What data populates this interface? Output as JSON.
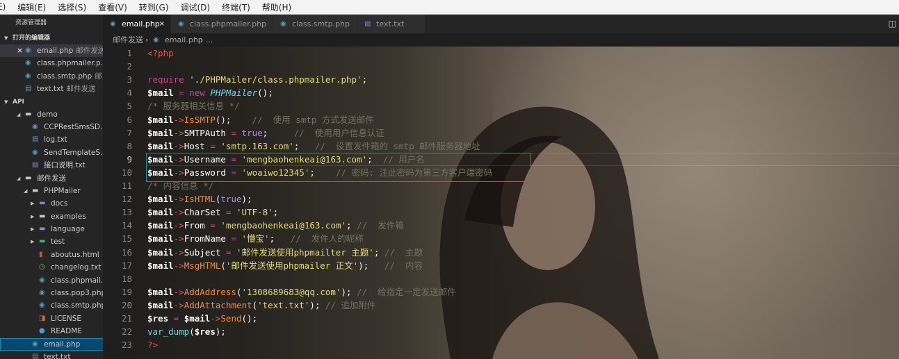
{
  "menu": [
    "E)",
    "编辑(E)",
    "选择(S)",
    "查看(V)",
    "转到(G)",
    "调试(D)",
    "终端(T)",
    "帮助(H)"
  ],
  "sidebar": {
    "title": "资源管理器",
    "open_editors_header": "打开的编辑器",
    "open_editors": [
      {
        "name": "email.php",
        "hint": "邮件发送",
        "icon": "php-icon",
        "active": true,
        "close": "×"
      },
      {
        "name": "class.phpmailer.p...",
        "hint": "",
        "icon": "php-icon"
      },
      {
        "name": "class.smtp.php",
        "hint": "邮...",
        "icon": "php-icon"
      },
      {
        "name": "text.txt",
        "hint": "邮件发送",
        "icon": "file-text-icon"
      }
    ],
    "api_header": "API",
    "tree": [
      {
        "name": "demo",
        "type": "folder",
        "depth": 1,
        "open": true
      },
      {
        "name": "CCPRestSmsSD...",
        "type": "php",
        "depth": 2
      },
      {
        "name": "log.txt",
        "type": "txt",
        "depth": 2
      },
      {
        "name": "SendTemplateS...",
        "type": "php",
        "depth": 2
      },
      {
        "name": "接口说明.txt",
        "type": "txt",
        "depth": 2
      },
      {
        "name": "邮件发送",
        "type": "folder",
        "depth": 1,
        "open": true
      },
      {
        "name": "PHPMailer",
        "type": "folder-special",
        "depth": 2,
        "open": true
      },
      {
        "name": "docs",
        "type": "folder-docs",
        "depth": 3,
        "open": false
      },
      {
        "name": "examples",
        "type": "folder",
        "depth": 3,
        "open": false
      },
      {
        "name": "language",
        "type": "folder-lang",
        "depth": 3,
        "open": false
      },
      {
        "name": "test",
        "type": "folder-test",
        "depth": 3,
        "open": false
      },
      {
        "name": "aboutus.html",
        "type": "html",
        "depth": 3
      },
      {
        "name": "changelog.txt",
        "type": "changelog",
        "depth": 3
      },
      {
        "name": "class.phpmail...",
        "type": "php",
        "depth": 3
      },
      {
        "name": "class.pop3.php",
        "type": "php",
        "depth": 3
      },
      {
        "name": "class.smtp.php",
        "type": "php",
        "depth": 3
      },
      {
        "name": "LICENSE",
        "type": "license",
        "depth": 3
      },
      {
        "name": "README",
        "type": "info",
        "depth": 3
      },
      {
        "name": "email.php",
        "type": "php",
        "depth": 2,
        "selected": true
      },
      {
        "name": "text.txt",
        "type": "txt",
        "depth": 2
      }
    ]
  },
  "tabs": [
    {
      "label": "email.php",
      "active": true,
      "close": "×"
    },
    {
      "label": "class.phpmailer.php"
    },
    {
      "label": "class.smtp.php"
    },
    {
      "label": "text.txt"
    }
  ],
  "breadcrumb": {
    "folder": "邮件发送",
    "sep": "›",
    "file": "email.php",
    "tail": "› ..."
  },
  "editor": {
    "current_line": 9,
    "lines": [
      [
        [
          "kw-tag",
          "<?php"
        ]
      ],
      [],
      [
        [
          "kw",
          "require"
        ],
        [
          "pun",
          " "
        ],
        [
          "str",
          "'./PHPMailer/class.phpmailer.php'"
        ],
        [
          "pun",
          ";"
        ]
      ],
      [
        [
          "var",
          "$mail"
        ],
        [
          "pun",
          " "
        ],
        [
          "kw",
          "="
        ],
        [
          "pun",
          " "
        ],
        [
          "kw",
          "new"
        ],
        [
          "pun",
          " "
        ],
        [
          "cls",
          "PHPMailer"
        ],
        [
          "pun",
          "();"
        ]
      ],
      [
        [
          "cm",
          "/* 服务器相关信息 */"
        ]
      ],
      [
        [
          "var",
          "$mail"
        ],
        [
          "arrow-op",
          "->"
        ],
        [
          "meth",
          "IsSMTP"
        ],
        [
          "pun",
          "();    "
        ],
        [
          "cm",
          "//  使用 smtp 方式发送邮件"
        ]
      ],
      [
        [
          "var",
          "$mail"
        ],
        [
          "arrow-op",
          "->"
        ],
        [
          "prop",
          "SMTPAuth"
        ],
        [
          "pun",
          " "
        ],
        [
          "kw",
          "="
        ],
        [
          "pun",
          " "
        ],
        [
          "bool",
          "true"
        ],
        [
          "pun",
          ";     "
        ],
        [
          "cm",
          "//  使用用户信息认证"
        ]
      ],
      [
        [
          "var",
          "$mail"
        ],
        [
          "arrow-op",
          "->"
        ],
        [
          "prop",
          "Host"
        ],
        [
          "pun",
          " "
        ],
        [
          "kw",
          "="
        ],
        [
          "pun",
          " "
        ],
        [
          "str",
          "'smtp.163.com'"
        ],
        [
          "pun",
          ";   "
        ],
        [
          "cm",
          "//  设置发件箱的 smtp 邮件服务器地址"
        ]
      ],
      [
        [
          "var",
          "$mail"
        ],
        [
          "arrow-op",
          "->"
        ],
        [
          "prop",
          "Username"
        ],
        [
          "pun",
          " "
        ],
        [
          "kw",
          "="
        ],
        [
          "pun",
          " "
        ],
        [
          "str",
          "'mengbaohenkeai@163.com'"
        ],
        [
          "pun",
          ";  "
        ],
        [
          "cm",
          "// 用户名"
        ]
      ],
      [
        [
          "var",
          "$mail"
        ],
        [
          "arrow-op",
          "->"
        ],
        [
          "prop",
          "Password"
        ],
        [
          "pun",
          " "
        ],
        [
          "kw",
          "="
        ],
        [
          "pun",
          " "
        ],
        [
          "str",
          "'woaiwo12345'"
        ],
        [
          "pun",
          ";    "
        ],
        [
          "cm",
          "// 密码: 注此密码为第三方客户端密码"
        ]
      ],
      [
        [
          "cm",
          "/* 内容信息 */"
        ]
      ],
      [
        [
          "var",
          "$mail"
        ],
        [
          "arrow-op",
          "->"
        ],
        [
          "meth",
          "IsHTML"
        ],
        [
          "pun",
          "("
        ],
        [
          "bool",
          "true"
        ],
        [
          "pun",
          ");"
        ]
      ],
      [
        [
          "var",
          "$mail"
        ],
        [
          "arrow-op",
          "->"
        ],
        [
          "prop",
          "CharSet"
        ],
        [
          "pun",
          " "
        ],
        [
          "kw",
          "="
        ],
        [
          "pun",
          " "
        ],
        [
          "str",
          "'UTF-8'"
        ],
        [
          "pun",
          ";"
        ]
      ],
      [
        [
          "var",
          "$mail"
        ],
        [
          "arrow-op",
          "->"
        ],
        [
          "prop",
          "From"
        ],
        [
          "pun",
          " "
        ],
        [
          "kw",
          "="
        ],
        [
          "pun",
          " "
        ],
        [
          "str",
          "'mengbaohenkeai@163.com'"
        ],
        [
          "pun",
          "; "
        ],
        [
          "cm",
          "//  发件箱"
        ]
      ],
      [
        [
          "var",
          "$mail"
        ],
        [
          "arrow-op",
          "->"
        ],
        [
          "prop",
          "FromName"
        ],
        [
          "pun",
          " "
        ],
        [
          "kw",
          "="
        ],
        [
          "pun",
          " "
        ],
        [
          "str",
          "'懵宝'"
        ],
        [
          "pun",
          ";   "
        ],
        [
          "cm",
          "//  发件人的昵称"
        ]
      ],
      [
        [
          "var",
          "$mail"
        ],
        [
          "arrow-op",
          "->"
        ],
        [
          "prop",
          "Subject"
        ],
        [
          "pun",
          " "
        ],
        [
          "kw",
          "="
        ],
        [
          "pun",
          " "
        ],
        [
          "str",
          "'邮件发送使用phpmailter 主题'"
        ],
        [
          "pun",
          "; "
        ],
        [
          "cm",
          "//  主题"
        ]
      ],
      [
        [
          "var",
          "$mail"
        ],
        [
          "arrow-op",
          "->"
        ],
        [
          "meth",
          "MsgHTML"
        ],
        [
          "pun",
          "("
        ],
        [
          "str",
          "'邮件发送使用phpmailer 正文'"
        ],
        [
          "pun",
          ");   "
        ],
        [
          "cm",
          "//  内容"
        ]
      ],
      [],
      [
        [
          "var",
          "$mail"
        ],
        [
          "arrow-op",
          "->"
        ],
        [
          "meth",
          "AddAddress"
        ],
        [
          "pun",
          "("
        ],
        [
          "str",
          "'1308689683@qq.com'"
        ],
        [
          "pun",
          "); "
        ],
        [
          "cm",
          "//  给指定一定发送邮件"
        ]
      ],
      [
        [
          "var",
          "$mail"
        ],
        [
          "arrow-op",
          "->"
        ],
        [
          "meth",
          "AddAttachment"
        ],
        [
          "pun",
          "("
        ],
        [
          "str",
          "'text.txt'"
        ],
        [
          "pun",
          "); "
        ],
        [
          "cm",
          "// 追加附件"
        ]
      ],
      [
        [
          "var",
          "$res"
        ],
        [
          "pun",
          " "
        ],
        [
          "kw",
          "="
        ],
        [
          "pun",
          " "
        ],
        [
          "var",
          "$mail"
        ],
        [
          "arrow-op",
          "->"
        ],
        [
          "meth",
          "Send"
        ],
        [
          "pun",
          "();"
        ]
      ],
      [
        [
          "fn",
          "var_dump"
        ],
        [
          "pun",
          "("
        ],
        [
          "var",
          "$res"
        ],
        [
          "pun",
          ");"
        ]
      ],
      [
        [
          "kw-tag",
          "?>"
        ]
      ]
    ]
  }
}
